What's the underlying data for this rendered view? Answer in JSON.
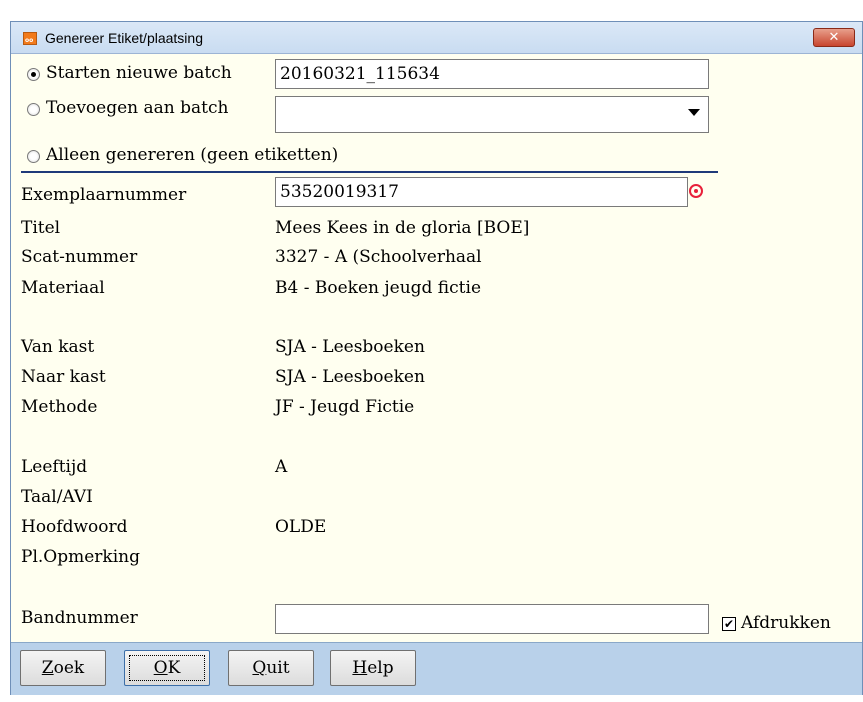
{
  "window": {
    "title": "Genereer Etiket/plaatsing",
    "close_symbol": "✕"
  },
  "batch": {
    "option_new": "Starten nieuwe batch",
    "new_batch_value": "20160321_115634",
    "option_add": "Toevoegen aan batch",
    "add_batch_value": "",
    "option_generate_only": "Alleen genereren (geen etiketten)"
  },
  "record": {
    "exemplaar_label": "Exemplaarnummer",
    "exemplaar_value": "53520019317",
    "titel_label": "Titel",
    "titel_value": "Mees Kees in de gloria [BOE]",
    "scat_label": "Scat-nummer",
    "scat_value": "3327 - A (Schoolverhaal",
    "materiaal_label": "Materiaal",
    "materiaal_value": "B4 - Boeken jeugd fictie",
    "van_kast_label": "Van kast",
    "van_kast_value": "SJA - Leesboeken",
    "naar_kast_label": "Naar kast",
    "naar_kast_value": "SJA - Leesboeken",
    "methode_label": "Methode",
    "methode_value": "JF - Jeugd Fictie",
    "leeftijd_label": "Leeftijd",
    "leeftijd_value": "A",
    "taal_label": "Taal/AVI",
    "taal_value": "",
    "hoofdwoord_label": "Hoofdwoord",
    "hoofdwoord_value": "OLDE",
    "opmerking_label": "Pl.Opmerking",
    "opmerking_value": "",
    "bandnummer_label": "Bandnummer",
    "bandnummer_value": "",
    "afdrukken_label": "Afdrukken",
    "afdrukken_checked": true,
    "check_symbol": "✔"
  },
  "buttons": {
    "zoek_first": "Z",
    "zoek_rest": "oek",
    "ok_first": "O",
    "ok_rest": "K",
    "quit_first": "Q",
    "quit_rest": "uit",
    "help_first": "H",
    "help_rest": "elp"
  },
  "icons": {
    "app": "app-icon",
    "target": "target-icon",
    "dropdown": "chevron-down-icon"
  },
  "colors": {
    "background": "#fffff0",
    "title_bar": "#c9dcf1",
    "button_bar": "#b9d1ea",
    "separator": "#1f3a7a",
    "close_button": "#c8452e",
    "target_icon": "#e8203a"
  }
}
